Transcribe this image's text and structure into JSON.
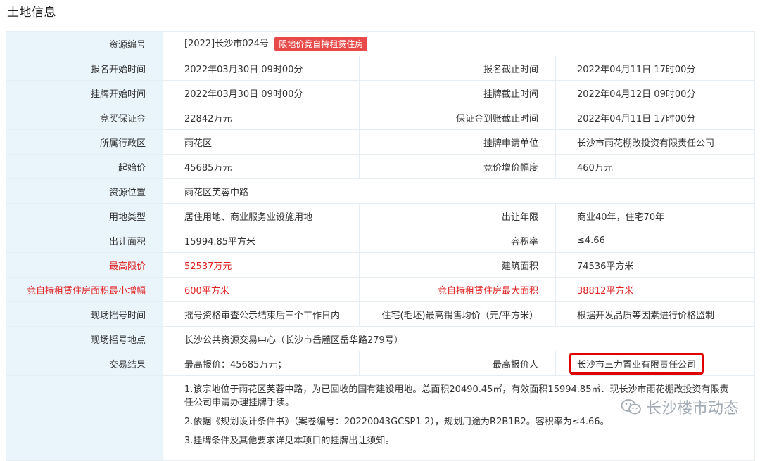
{
  "page_title": "土地信息",
  "rows": {
    "r1": {
      "label": "资源编号",
      "value": "[2022]长沙市024号",
      "tag": "限地价竞自持租赁住房"
    },
    "r2": {
      "label": "报名开始时间",
      "value": "2022年03月30日 09时00分",
      "label2": "报名截止时间",
      "value2": "2022年04月11日 17时00分"
    },
    "r3": {
      "label": "挂牌开始时间",
      "value": "2022年03月30日 09时00分",
      "label2": "挂牌截止时间",
      "value2": "2022年04月12日 09时00分"
    },
    "r4": {
      "label": "竞买保证金",
      "value": "22842万元",
      "label2": "保证金到账截止时间",
      "value2": "2022年04月11日 17时00分"
    },
    "r5": {
      "label": "所属行政区",
      "value": "雨花区",
      "label2": "挂牌申请单位",
      "value2": "长沙市雨花棚改投资有限责任公司"
    },
    "r6": {
      "label": "起始价",
      "value": "45685万元",
      "label2": "竞价增价幅度",
      "value2": "460万元"
    },
    "r7": {
      "label": "资源位置",
      "value": "雨花区芙蓉中路"
    },
    "r8": {
      "label": "用地类型",
      "value": "居住用地、商业服务业设施用地",
      "label2": "出让年限",
      "value2": "商业40年，住宅70年"
    },
    "r9": {
      "label": "出让面积",
      "value": "15994.85平方米",
      "label2": "容积率",
      "value2": "≤4.66"
    },
    "r10": {
      "label": "最高限价",
      "value": "52537万元",
      "label2": "建筑面积",
      "value2": "74536平方米"
    },
    "r11": {
      "label": "竞自持租赁住房面积最小增幅",
      "value": "600平方米",
      "label2": "竞自持租赁住房最大面积",
      "value2": "38812平方米"
    },
    "r12": {
      "label": "现场摇号时间",
      "value": "摇号资格审查公示结束后三个工作日内",
      "label2": "住宅(毛坯)最高销售均价（元/平方米）",
      "value2": "根据开发品质等因素进行价格监制"
    },
    "r13": {
      "label": "现场摇号地点",
      "value": "长沙公共资源交易中心（长沙市岳麓区岳华路279号）"
    },
    "r14": {
      "label": "交易结果",
      "value": "最高报价：45685万元；",
      "label2": "最高报价人",
      "value2": "长沙市三力置业有限责任公司"
    }
  },
  "notes": [
    "1.该宗地位于雨花区芙蓉中路，为已回收的国有建设用地。总面积20490.45㎡，有效面积15994.85㎡．现长沙市雨花棚改投资有限责任公司申请办理挂牌手续。",
    "2.依据《规划设计条件书》（案卷编号：20220043GCSP1-2），规划用途为R2B1B2。容积率为≤4.66。",
    "3.挂牌条件及其他要求详见本项目的挂牌出让须知。"
  ],
  "watermark": "长沙楼市动态",
  "colors": {
    "label_bg": "#eaf5fb",
    "highlight_red": "#e02020",
    "tag_bg": "#e84a4a",
    "box_border": "#e00000"
  }
}
